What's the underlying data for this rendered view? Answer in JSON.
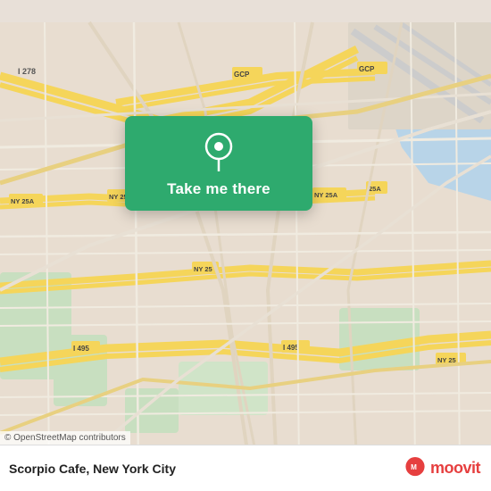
{
  "map": {
    "background_color": "#e8ddd0",
    "osm_credit": "© OpenStreetMap contributors",
    "road_color_highway": "#f5d55a",
    "road_color_minor": "#ffffff",
    "road_color_major": "#f5d55a",
    "water_color": "#b8d4e8"
  },
  "location_card": {
    "background": "#2eaa6e",
    "button_label": "Take me there",
    "pin_color": "#ffffff"
  },
  "bottom_bar": {
    "location_name": "Scorpio Cafe, New York City",
    "location_title": "Scorpio Cafe",
    "location_city": "New York City",
    "moovit_label": "moovit",
    "osm_credit": "© OpenStreetMap contributors"
  }
}
